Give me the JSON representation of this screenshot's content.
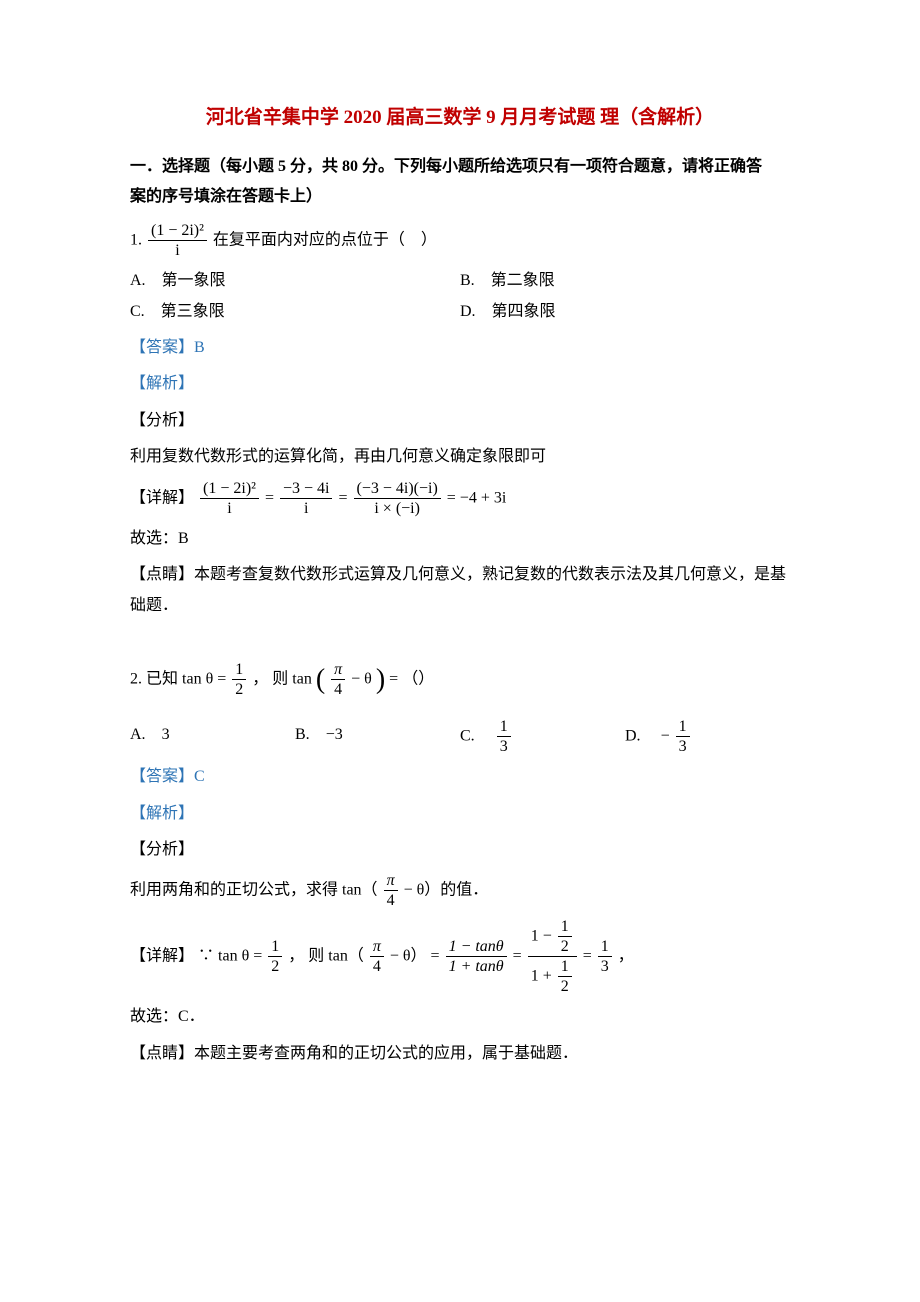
{
  "title": "河北省辛集中学 2020 届高三数学 9 月月考试题 理（含解析）",
  "section": {
    "header_l1": "一．选择题（每小题 5 分，共 80 分。下列每小题所给选项只有一项符合题意，请将正确答",
    "header_l2": "案的序号填涂在答题卡上）"
  },
  "q1": {
    "num": "1.",
    "expr_num": "(1 − 2i)²",
    "expr_den": "i",
    "question_tail": " 在复平面内对应的点位于（　）",
    "optA": "A.　第一象限",
    "optB": "B.　第二象限",
    "optC": "C.　第三象限",
    "optD": "D.　第四象限",
    "answer_label": "【答案】",
    "answer_val": "B",
    "jiexi": "【解析】",
    "fenxi": "【分析】",
    "fenxi_text": "利用复数代数形式的运算化简，再由几何意义确定象限即可",
    "detail_label": "【详解】",
    "d_f1_num": "(1 − 2i)²",
    "d_f1_den": "i",
    "d_f2_num": "−3 − 4i",
    "d_f2_den": "i",
    "d_f3_num": "(−3 − 4i)(−i)",
    "d_f3_den": "i × (−i)",
    "d_result": " = −4 + 3i",
    "guxuan": "故选：B",
    "dianjing": "【点睛】本题考查复数代数形式运算及几何意义，熟记复数的代数表示法及其几何意义，是基础题．"
  },
  "q2": {
    "num": "2.",
    "lead1": "已知 ",
    "tan_eq": "tan θ = ",
    "tan_num": "1",
    "tan_den": "2",
    "lead2": " ， 则 ",
    "tan2_pre": "tan",
    "tan2_inner_num": "π",
    "tan2_inner_den": "4",
    "tan2_inner_suffix": " − θ",
    "tail": " = （）",
    "optA_label": "A.　",
    "optA_val": "3",
    "optB_label": "B.　",
    "optB_val": "−3",
    "optC_label": "C.　",
    "optC_num": "1",
    "optC_den": "3",
    "optD_label": "D.　",
    "optD_pre": "−",
    "optD_num": "1",
    "optD_den": "3",
    "answer_label": "【答案】",
    "answer_val": "C",
    "jiexi": "【解析】",
    "fenxi": "【分析】",
    "fenxi_pre": "利用两角和的正切公式，求得 tan（",
    "fenxi_num": "π",
    "fenxi_den": "4",
    "fenxi_suffix": " − θ）的值．",
    "detail_label": "【详解】",
    "d_lead": "∵ tan θ = ",
    "d_tan_num": "1",
    "d_tan_den": "2",
    "d_mid1": "， 则 tan（",
    "d_mid_num": "π",
    "d_mid_den": "4",
    "d_mid2": " − θ） = ",
    "d_f1_num": "1 − tanθ",
    "d_f1_den": "1 + tanθ",
    "eq": " = ",
    "d_f2_num_pre": "1 − ",
    "d_f2_num_num": "1",
    "d_f2_num_den": "2",
    "d_f2_den_pre": "1 + ",
    "d_f2_den_num": "1",
    "d_f2_den_den": "2",
    "d_f3_num": "1",
    "d_f3_den": "3",
    "comma": "，",
    "guxuan": "故选：C．",
    "dianjing": "【点睛】本题主要考查两角和的正切公式的应用，属于基础题．"
  }
}
